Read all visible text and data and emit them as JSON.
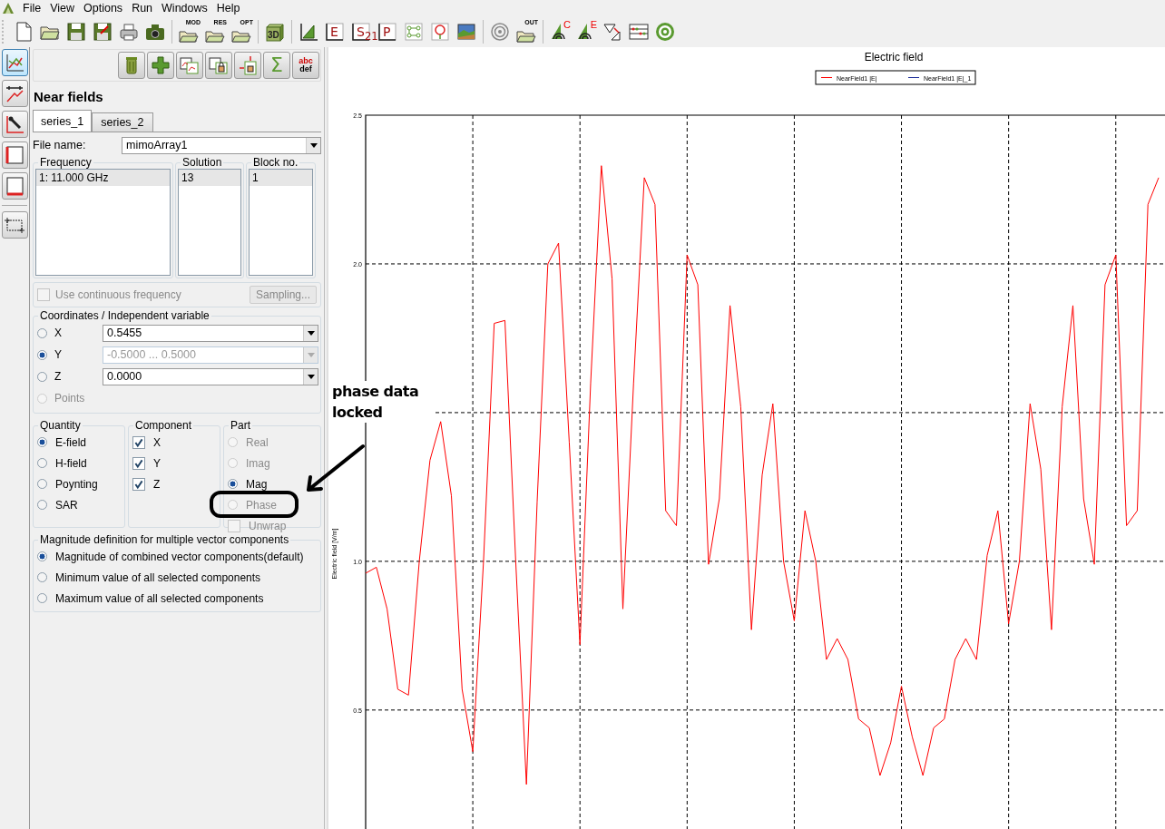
{
  "menu": [
    "File",
    "View",
    "Options",
    "Run",
    "Windows",
    "Help"
  ],
  "toolbar": [
    {
      "kind": "new"
    },
    {
      "kind": "open"
    },
    {
      "kind": "save"
    },
    {
      "kind": "save-edit"
    },
    {
      "kind": "print"
    },
    {
      "kind": "camera"
    },
    {
      "kind": "separator"
    },
    {
      "kind": "folder",
      "label": "MOD"
    },
    {
      "kind": "folder",
      "label": "RES"
    },
    {
      "kind": "folder",
      "label": "OPT"
    },
    {
      "kind": "separator"
    },
    {
      "kind": "cube",
      "label": "3D"
    },
    {
      "kind": "separator"
    },
    {
      "kind": "plot"
    },
    {
      "kind": "letter",
      "label": "E"
    },
    {
      "kind": "letter",
      "label": "S$_{21}$"
    },
    {
      "kind": "letter",
      "label": "P"
    },
    {
      "kind": "network"
    },
    {
      "kind": "pin"
    },
    {
      "kind": "picture"
    },
    {
      "kind": "separator"
    },
    {
      "kind": "rings"
    },
    {
      "kind": "folder",
      "label": "OUT"
    },
    {
      "kind": "separator"
    },
    {
      "kind": "antenna",
      "label": "C"
    },
    {
      "kind": "antenna",
      "label": "E"
    },
    {
      "kind": "transform"
    },
    {
      "kind": "abacus"
    },
    {
      "kind": "target"
    }
  ],
  "side_tools": [
    {
      "kind": "graph",
      "selected": true
    },
    {
      "kind": "wrench-graph",
      "selected": false
    },
    {
      "kind": "wrench-axes",
      "selected": false
    },
    {
      "kind": "axes-left",
      "selected": false
    },
    {
      "kind": "axes-bottom",
      "selected": false
    },
    {
      "kind": "zoom-box",
      "selected": false
    }
  ],
  "panel_tools": [
    {
      "kind": "trash"
    },
    {
      "kind": "plus"
    },
    {
      "kind": "copy-graph"
    },
    {
      "kind": "lock-graph"
    },
    {
      "kind": "import"
    },
    {
      "kind": "sum",
      "label": "Σ"
    },
    {
      "kind": "text",
      "label": "abc",
      "label_2": "def"
    }
  ],
  "panel": {
    "title": "Near fields",
    "tabs": [
      {
        "label": "series_1",
        "selected": true
      },
      {
        "label": "series_2",
        "selected": false
      }
    ],
    "file_name": {
      "label": "File name:",
      "value": "mimoArray1"
    },
    "lists": [
      {
        "heading": "Frequency",
        "items": [
          {
            "text": "1: 11.000 GHz",
            "selected": true
          }
        ]
      },
      {
        "heading": "Solution",
        "items": [
          {
            "text": "13",
            "selected": true
          }
        ]
      },
      {
        "heading": "Block no.",
        "items": [
          {
            "text": "1",
            "selected": true
          }
        ]
      }
    ],
    "continuous": {
      "label": "Use continuous frequency",
      "checked": false,
      "disabled": true
    },
    "sampling": {
      "label": "Sampling...",
      "disabled": true
    },
    "coordinates": {
      "heading": "Coordinates / Independent variable",
      "options": [
        {
          "label": "X",
          "selected": false,
          "disabled": false,
          "value": "0.5455",
          "field_disabled": false
        },
        {
          "label": "Y",
          "selected": true,
          "disabled": false,
          "value": "-0.5000 ... 0.5000",
          "field_disabled": true
        },
        {
          "label": "Z",
          "selected": false,
          "disabled": false,
          "value": "0.0000",
          "field_disabled": false
        },
        {
          "label": "Points",
          "selected": false,
          "disabled": true
        }
      ]
    },
    "quantity": {
      "heading": "Quantity",
      "options": [
        {
          "label": "E-field",
          "selected": true
        },
        {
          "label": "H-field",
          "selected": false
        },
        {
          "label": "Poynting",
          "selected": false
        },
        {
          "label": "SAR",
          "selected": false
        }
      ]
    },
    "component": {
      "heading": "Component",
      "options": [
        {
          "label": "X",
          "checked": true
        },
        {
          "label": "Y",
          "checked": true
        },
        {
          "label": "Z",
          "checked": true
        }
      ]
    },
    "part": {
      "heading": "Part",
      "options": [
        {
          "kind": "radio",
          "label": "Real",
          "selected": false,
          "disabled": true
        },
        {
          "kind": "radio",
          "label": "Imag",
          "selected": false,
          "disabled": true
        },
        {
          "kind": "radio",
          "label": "Mag",
          "selected": true,
          "disabled": false
        },
        {
          "kind": "radio",
          "label": "Phase",
          "selected": false,
          "disabled": true
        },
        {
          "kind": "checkbox",
          "label": "Unwrap",
          "checked": false,
          "disabled": true
        }
      ]
    },
    "magnitude": {
      "heading": "Magnitude definition for multiple vector components",
      "options": [
        {
          "label": "Magnitude of combined vector components(default)",
          "selected": true
        },
        {
          "label": "Minimum value of all selected components",
          "selected": false
        },
        {
          "label": "Maximum value of all selected components",
          "selected": false
        }
      ]
    }
  },
  "annotation": {
    "text": "phase data locked"
  },
  "chart": {
    "chart_data": {
      "type": "line",
      "title": "Electric field",
      "ylabel": "Electric field [V/m]",
      "ylim": [
        0.1,
        2.5
      ],
      "grid": true,
      "legend": true,
      "yticks": [
        {
          "value": 0.5,
          "label": "0.5"
        },
        {
          "value": 1.0,
          "label": "1.0"
        },
        {
          "value": 2.0,
          "label": "2.0"
        },
        {
          "value": 2.5,
          "label": "2.5"
        }
      ],
      "series": [
        {
          "name": "NearField1 |E|",
          "color": "#ff0000",
          "values": [
            0.96,
            0.98,
            0.84,
            0.57,
            0.55,
            1.0,
            1.34,
            1.47,
            1.22,
            0.57,
            0.36,
            1.0,
            1.8,
            1.81,
            1.0,
            0.25,
            1.2,
            2.0,
            2.07,
            1.4,
            0.72,
            1.6,
            2.33,
            1.95,
            0.84,
            1.6,
            2.29,
            2.2,
            1.17,
            1.12,
            2.03,
            1.93,
            0.99,
            1.21,
            1.86,
            1.52,
            0.77,
            1.29,
            1.53,
            1.0,
            0.8,
            1.17,
            1.0,
            0.67,
            0.74,
            0.67,
            0.47,
            0.44,
            0.28,
            0.39,
            0.58,
            0.41,
            0.28,
            0.44,
            0.47,
            0.67,
            0.74,
            0.67,
            1.02,
            1.17,
            0.79,
            1.0,
            1.53,
            1.31,
            0.77,
            1.52,
            1.86,
            1.21,
            0.99,
            1.93,
            2.03,
            1.12,
            1.17,
            2.2,
            2.29
          ]
        },
        {
          "name": "NearField1 |E|_1",
          "color": "#1f2f9a",
          "values": [
            null,
            null,
            null,
            null,
            null,
            null,
            null,
            null,
            null,
            null,
            null,
            null,
            null,
            null,
            null,
            null,
            null,
            null,
            null,
            null,
            null,
            null,
            null,
            null,
            null,
            null,
            null,
            null,
            null,
            null,
            null,
            null,
            null,
            null,
            null,
            null,
            null,
            null,
            null,
            null,
            null,
            null,
            null,
            null,
            null,
            null,
            null,
            null,
            null,
            null,
            null,
            null,
            null,
            null,
            null,
            null,
            null,
            null,
            null,
            null,
            null,
            null,
            null,
            null,
            null,
            null,
            null,
            null,
            null,
            null,
            null,
            null,
            null,
            null,
            null
          ]
        }
      ]
    }
  }
}
